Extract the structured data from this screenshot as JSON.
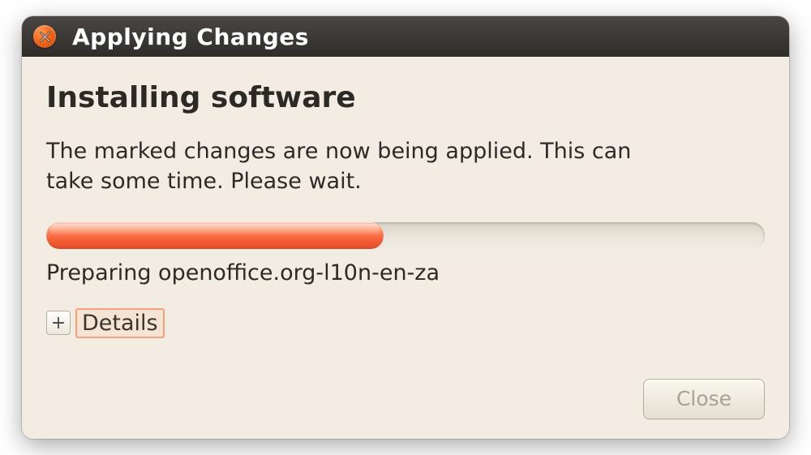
{
  "window": {
    "title": "Applying Changes"
  },
  "content": {
    "heading": "Installing software",
    "description": "The marked changes are now being applied. This can take some time. Please wait.",
    "progress_percent": 47,
    "status": "Preparing openoffice.org-l10n-en-za",
    "details_label": "Details",
    "expander_symbol": "+"
  },
  "buttons": {
    "close": "Close"
  }
}
